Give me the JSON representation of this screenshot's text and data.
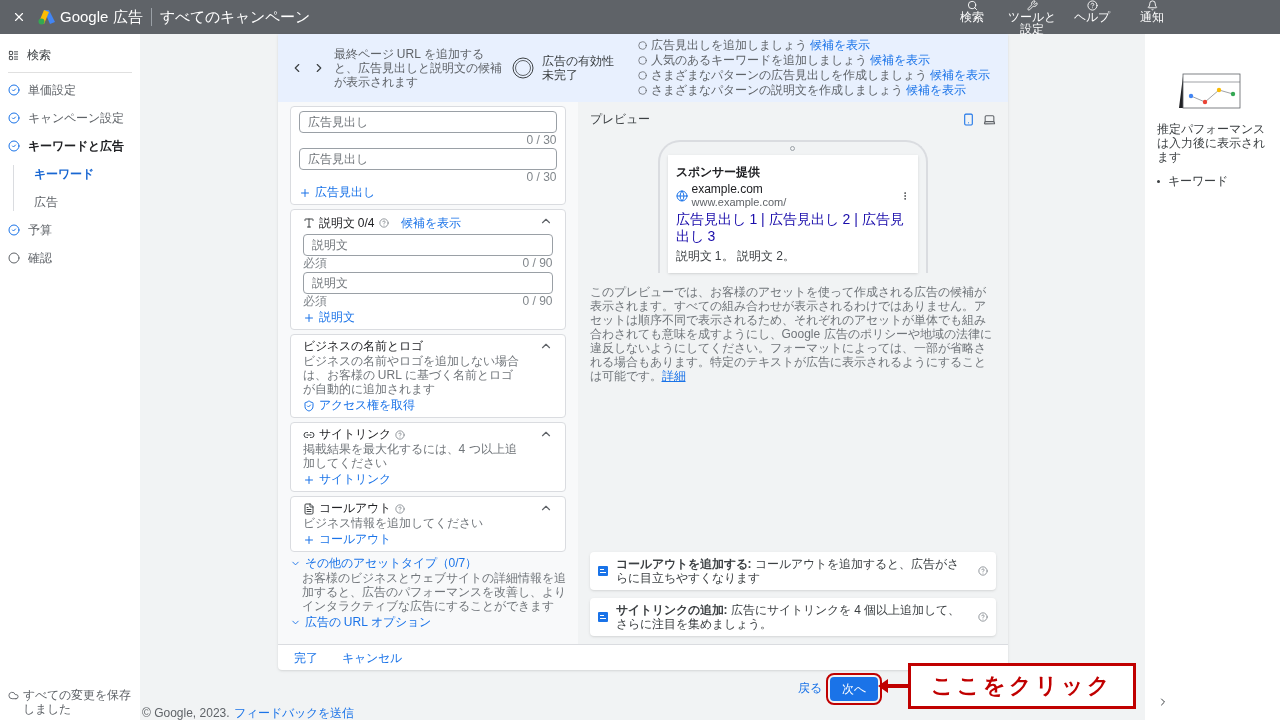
{
  "header": {
    "brand": "Google 広告",
    "title": "すべてのキャンペーン",
    "tools": [
      {
        "kind": "search",
        "label": "検索"
      },
      {
        "kind": "wrench",
        "label": "ツールと設定"
      },
      {
        "kind": "help",
        "label": "ヘルプ"
      },
      {
        "kind": "bell",
        "label": "通知"
      }
    ]
  },
  "sidebar": {
    "search": "検索",
    "steps": [
      {
        "label": "単価設定",
        "done": true,
        "selected": false
      },
      {
        "label": "キャンペーン設定",
        "done": true,
        "selected": false
      },
      {
        "label": "キーワードと広告",
        "done": true,
        "selected": true,
        "children": [
          {
            "label": "キーワード",
            "selected": true
          },
          {
            "label": "広告",
            "selected": false
          }
        ]
      },
      {
        "label": "予算",
        "done": true,
        "selected": false
      },
      {
        "label": "確認",
        "done": false,
        "selected": false
      }
    ],
    "save_status": "すべての変更を保存しました"
  },
  "banner": {
    "message": "最終ページ URL を追加すると、広告見出しと説明文の候補が表示されます",
    "strength_label": "広告の有効性",
    "strength_value": "未完了",
    "tips": [
      {
        "text": "広告見出しを追加しましょう",
        "link": "候補を表示"
      },
      {
        "text": "人気のあるキーワードを追加しましょう",
        "link": "候補を表示"
      },
      {
        "text": "さまざまなパターンの広告見出しを作成しましょう",
        "link": "候補を表示"
      },
      {
        "text": "さまざまなパターンの説明文を作成しましょう",
        "link": "候補を表示"
      }
    ]
  },
  "headlines": {
    "fields": [
      {
        "placeholder": "広告見出し",
        "counter": "0 / 30"
      },
      {
        "placeholder": "広告見出し",
        "counter": "0 / 30"
      }
    ],
    "add": "広告見出し"
  },
  "sections": [
    {
      "kind": "description",
      "title": "説明文 0/4",
      "link": "候補を表示",
      "expanded": true,
      "fields": [
        {
          "placeholder": "説明文",
          "hint": "必須",
          "counter": "0 / 90"
        },
        {
          "placeholder": "説明文",
          "hint": "必須",
          "counter": "0 / 90"
        }
      ],
      "add": "説明文"
    },
    {
      "kind": "business",
      "title": "ビジネスの名前とロゴ",
      "text": "ビジネスの名前やロゴを追加しない場合は、お客様の URL に基づく名前とロゴが自動的に追加されます",
      "expanded": true,
      "action": "アクセス権を取得"
    },
    {
      "kind": "sitelink",
      "title": "サイトリンク",
      "text": "掲載結果を最大化するには、4 つ以上追加してください",
      "expanded": true,
      "add": "サイトリンク"
    },
    {
      "kind": "callout",
      "title": "コールアウト",
      "text": "ビジネス情報を追加してください",
      "expanded": true,
      "add": "コールアウト"
    }
  ],
  "other_assets": {
    "label": "その他のアセットタイプ（0/7）",
    "text": "お客様のビジネスとウェブサイトの詳細情報を追加すると、広告のパフォーマンスを改善し、よりインタラクティブな広告にすることができます"
  },
  "url_options": "広告の URL オプション",
  "preview": {
    "title": "プレビュー",
    "devices": [
      {
        "kind": "mobile",
        "selected": true
      },
      {
        "kind": "desktop",
        "selected": false
      }
    ],
    "ad": {
      "sponsor": "スポンサー提供",
      "domain": "example.com",
      "url": "www.example.com/",
      "headline": "広告見出し 1 | 広告見出し 2 | 広告見出し 3",
      "description": "説明文 1。 説明文 2。"
    },
    "disclaimer": "このプレビューでは、お客様のアセットを使って作成される広告の候補が表示されます。すべての組み合わせが表示されるわけではありません。アセットは順序不同で表示されるため、それぞれのアセットが単体でも組み合わされても意味を成すようにし、Google 広告のポリシーや地域の法律に違反しないようにしてください。フォーマットによっては、一部が省略される場合もあります。特定のテキストが広告に表示されるようにすることは可能です。",
    "disclaimer_link": "詳細",
    "suggestions": [
      "**コールアウトを追加する:** コールアウトを追加すると、広告がさらに目立ちやすくなります",
      "**サイトリンクの追加:** 広告にサイトリンクを 4 個以上追加して、さらに注目を集めましょう。"
    ]
  },
  "card_actions": [
    "完了",
    "キャンセル"
  ],
  "performance": {
    "text": "推定パフォーマンスは入力後に表示されます",
    "items": [
      "キーワード"
    ]
  },
  "nav": {
    "back": "戻る",
    "next": "次へ"
  },
  "annotation": "ここをクリック",
  "footer": {
    "copyright": "© Google, 2023.",
    "link": "フィードバックを送信"
  }
}
